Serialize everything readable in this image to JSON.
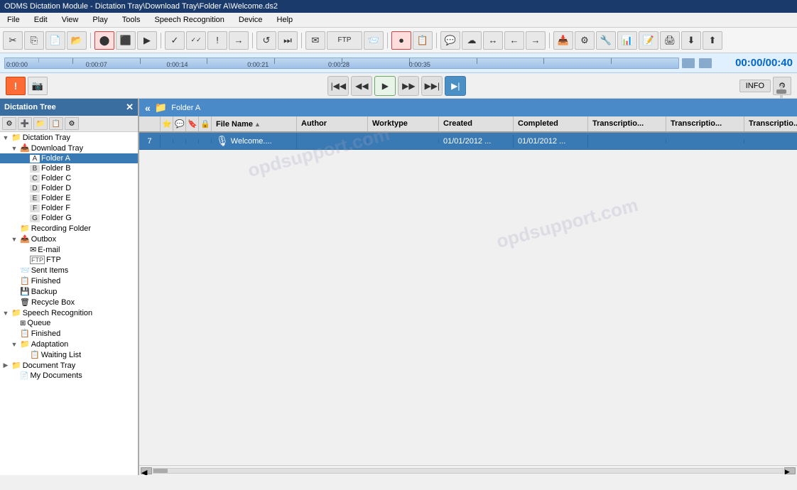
{
  "app": {
    "title": "ODMS Dictation Module - Dictation Tray\\Download Tray\\Folder A\\Welcome.ds2"
  },
  "menubar": {
    "items": [
      "File",
      "Edit",
      "View",
      "Play",
      "Tools",
      "Speech Recognition",
      "Device",
      "Help"
    ]
  },
  "timeline": {
    "current_time": "00:00",
    "total_time": "00:40",
    "position_percent": 0
  },
  "folder_header": {
    "label": "Folder A",
    "nav_back": "«"
  },
  "columns": {
    "num": "#",
    "icons": "",
    "filename": "File Name",
    "author": "Author",
    "worktype": "Worktype",
    "created": "Created",
    "completed": "Completed",
    "transcription1": "Transcriptio...",
    "transcription2": "Transcriptio...",
    "transcription3": "Transcriptio..."
  },
  "files": [
    {
      "num": "7",
      "filename": "Welcome....",
      "author": "",
      "worktype": "",
      "created": "01/01/2012 ...",
      "completed": "01/01/2012 ...",
      "trans1": "",
      "trans2": "",
      "trans3": ""
    }
  ],
  "tree": {
    "title": "Dictation Tree",
    "items": [
      {
        "id": "dictation-tray",
        "label": "Dictation Tray",
        "level": 0,
        "expanded": true,
        "icon": "📁",
        "has_expand": true
      },
      {
        "id": "download-tray",
        "label": "Download Tray",
        "level": 1,
        "expanded": true,
        "icon": "📥",
        "has_expand": true
      },
      {
        "id": "folder-a",
        "label": "Folder A",
        "level": 2,
        "icon": "📄",
        "has_expand": false,
        "letter": "A"
      },
      {
        "id": "folder-b",
        "label": "Folder B",
        "level": 2,
        "icon": "📄",
        "has_expand": false,
        "letter": "B"
      },
      {
        "id": "folder-c",
        "label": "Folder C",
        "level": 2,
        "icon": "📄",
        "has_expand": false,
        "letter": "C"
      },
      {
        "id": "folder-d",
        "label": "Folder D",
        "level": 2,
        "icon": "📄",
        "has_expand": false,
        "letter": "D"
      },
      {
        "id": "folder-e",
        "label": "Folder E",
        "level": 2,
        "icon": "📄",
        "has_expand": false,
        "letter": "E"
      },
      {
        "id": "folder-f",
        "label": "Folder F",
        "level": 2,
        "icon": "📄",
        "has_expand": false,
        "letter": "F"
      },
      {
        "id": "folder-g",
        "label": "Folder G",
        "level": 2,
        "icon": "📄",
        "has_expand": false,
        "letter": "G"
      },
      {
        "id": "recording-folder",
        "label": "Recording Folder",
        "level": 1,
        "icon": "📁",
        "has_expand": false
      },
      {
        "id": "outbox",
        "label": "Outbox",
        "level": 1,
        "expanded": true,
        "icon": "📤",
        "has_expand": true
      },
      {
        "id": "email",
        "label": "E-mail",
        "level": 2,
        "icon": "✉️",
        "has_expand": false
      },
      {
        "id": "ftp",
        "label": "FTP",
        "level": 2,
        "icon": "📡",
        "has_expand": false
      },
      {
        "id": "sent-items",
        "label": "Sent Items",
        "level": 1,
        "icon": "📨",
        "has_expand": false
      },
      {
        "id": "finished",
        "label": "Finished",
        "level": 1,
        "icon": "📋",
        "has_expand": false
      },
      {
        "id": "backup",
        "label": "Backup",
        "level": 1,
        "icon": "💾",
        "has_expand": false
      },
      {
        "id": "recycle-box",
        "label": "Recycle Box",
        "level": 1,
        "icon": "🗑",
        "has_expand": false
      },
      {
        "id": "speech-recognition",
        "label": "Speech Recognition",
        "level": 0,
        "expanded": true,
        "icon": "🎤",
        "has_expand": true
      },
      {
        "id": "queue",
        "label": "Queue",
        "level": 1,
        "icon": "📋",
        "has_expand": false
      },
      {
        "id": "sr-finished",
        "label": "Finished",
        "level": 1,
        "icon": "📋",
        "has_expand": false
      },
      {
        "id": "adaptation",
        "label": "Adaptation",
        "level": 1,
        "expanded": true,
        "icon": "🔧",
        "has_expand": true
      },
      {
        "id": "waiting-list",
        "label": "Waiting List",
        "level": 2,
        "icon": "📋",
        "has_expand": false
      },
      {
        "id": "document-tray",
        "label": "Document Tray",
        "level": 0,
        "expanded": false,
        "icon": "📁",
        "has_expand": true
      },
      {
        "id": "my-documents",
        "label": "My Documents",
        "level": 1,
        "icon": "📄",
        "has_expand": false
      }
    ]
  },
  "playback": {
    "rewind_all": "⏮",
    "rewind": "⏪",
    "play": "▶",
    "fast_forward": "⏩",
    "forward_all": "⏭",
    "last": "⏭",
    "info": "INFO",
    "settings": "⚙"
  },
  "toolbar_icons": {
    "cut": "✂",
    "copy": "⎘",
    "new": "📄",
    "open": "📂",
    "record": "🔴",
    "stop": "⬛",
    "playback": "▶",
    "check": "✓",
    "checkmark2": "✓✓",
    "send": "→",
    "refresh": "↺",
    "skip": "⏭",
    "send2": "📤",
    "email": "✉",
    "ftp": "📡",
    "send3": "📨",
    "record2": "🔴",
    "new2": "📋",
    "comment": "💬",
    "cloud": "☁",
    "arrows": "↔",
    "share": "⤴",
    "back": "←",
    "forward": "→"
  },
  "colors": {
    "header_bg": "#1a3a6b",
    "selected_row": "#3a7ab4",
    "folder_header": "#3a7ab4",
    "timeline_time": "#0066cc"
  },
  "watermark_text": "opdsupport.com"
}
